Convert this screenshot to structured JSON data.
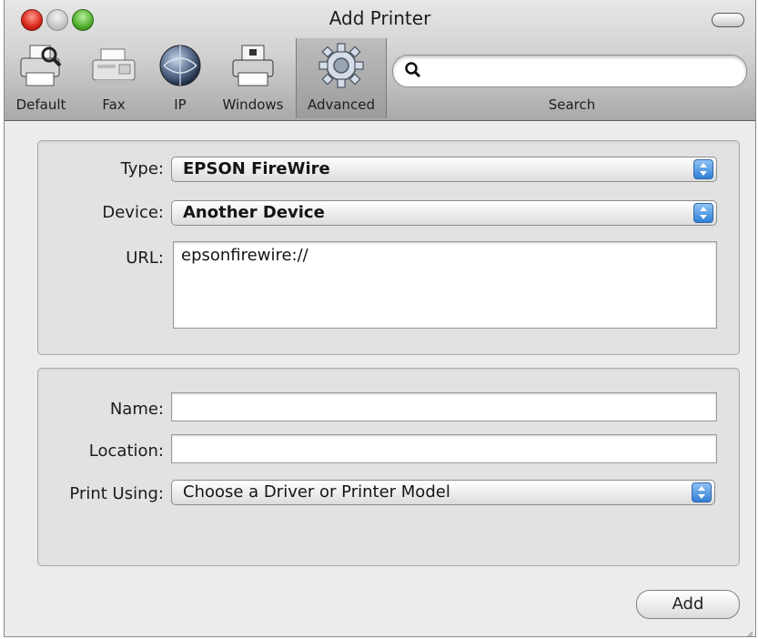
{
  "window": {
    "title": "Add Printer"
  },
  "toolbar": {
    "items": [
      {
        "label": "Default",
        "icon": "default-printer-icon"
      },
      {
        "label": "Fax",
        "icon": "fax-icon"
      },
      {
        "label": "IP",
        "icon": "ip-globe-icon"
      },
      {
        "label": "Windows",
        "icon": "windows-printer-icon"
      },
      {
        "label": "Advanced",
        "icon": "gear-icon",
        "selected": true
      }
    ],
    "search": {
      "label": "Search",
      "value": "",
      "placeholder": ""
    }
  },
  "connection": {
    "type_label": "Type:",
    "type_value": "EPSON FireWire",
    "device_label": "Device:",
    "device_value": "Another Device",
    "url_label": "URL:",
    "url_value": "epsonfirewire://"
  },
  "details": {
    "name_label": "Name:",
    "name_value": "",
    "location_label": "Location:",
    "location_value": "",
    "print_using_label": "Print Using:",
    "print_using_value": "Choose a Driver or Printer Model"
  },
  "actions": {
    "add_label": "Add"
  }
}
